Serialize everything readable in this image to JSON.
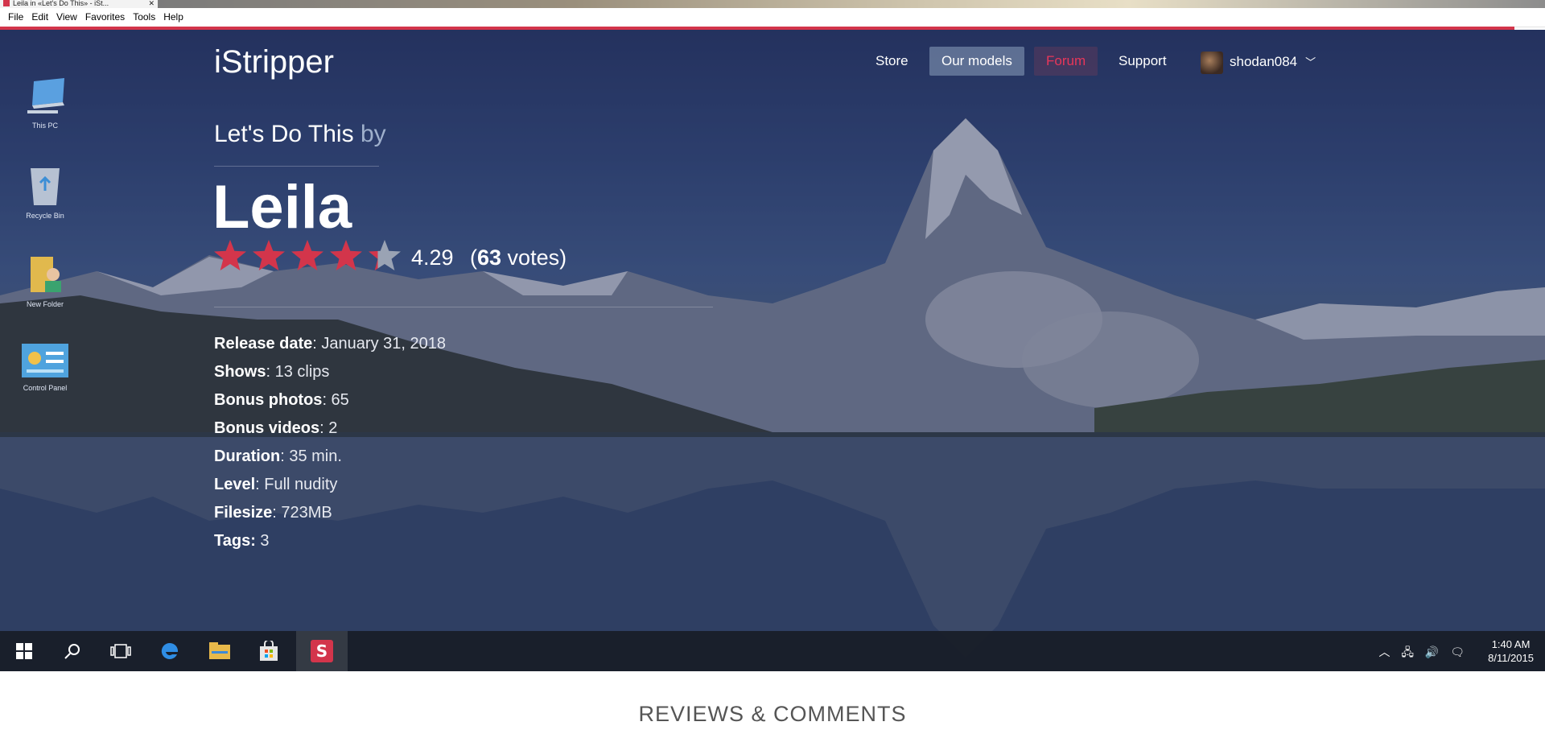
{
  "window": {
    "tab_title": "Leila in «Let's Do This» - iSt..."
  },
  "menu": [
    "File",
    "Edit",
    "View",
    "Favorites",
    "Tools",
    "Help"
  ],
  "desktop_icons": [
    "This PC",
    "Recycle Bin",
    "New Folder",
    "Control Panel"
  ],
  "site": {
    "logo": "iStripper",
    "nav": {
      "store": "Store",
      "models": "Our models",
      "forum": "Forum",
      "support": "Support"
    },
    "user": "shodan084",
    "accent_color": "#d3354b"
  },
  "show": {
    "title": "Let's Do This",
    "by": "by",
    "model": "Leila",
    "rating": "4.29",
    "rating_value": 4.29,
    "rating_max": 5,
    "votes_open": "(",
    "votes_count": "63",
    "votes_label": " votes)"
  },
  "details": [
    {
      "label": "Release date",
      "value": ": January 31, 2018"
    },
    {
      "label": "Shows",
      "value": ": 13 clips"
    },
    {
      "label": "Bonus photos",
      "value": ": 65"
    },
    {
      "label": "Bonus videos",
      "value": ": 2"
    },
    {
      "label": "Duration",
      "value": ": 35 min."
    },
    {
      "label": "Level",
      "value": ": Full nudity"
    },
    {
      "label": "Filesize",
      "value": ": 723MB"
    },
    {
      "label": "Tags:",
      "value": " 3"
    }
  ],
  "taskbar": {
    "time": "1:40 AM",
    "date": "8/11/2015"
  },
  "reviews_heading": "REVIEWS & COMMENTS"
}
